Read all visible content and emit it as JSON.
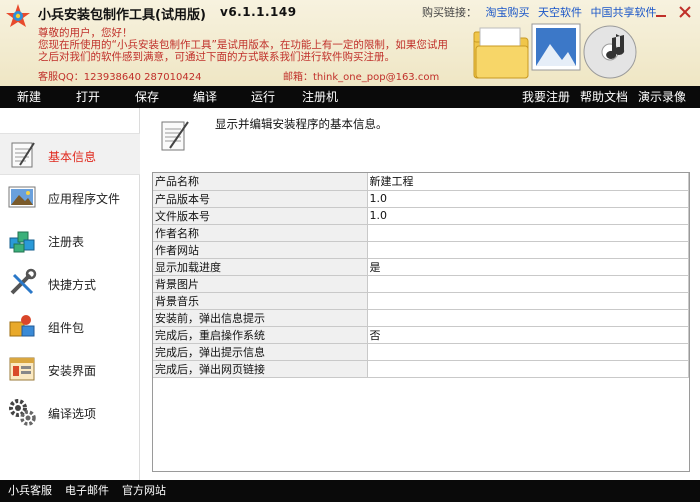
{
  "header": {
    "title": "小兵安装包制作工具(试用版)",
    "version": "v6.1.1.149",
    "buy_label": "购买链接：",
    "buy_links": [
      "淘宝购买",
      "天空软件",
      "中国共享软件"
    ],
    "notice_lines": [
      "尊敬的用户，您好！",
      "您现在所使用的“小兵安装包制作工具”是试用版本，在功能上有一定的限制，如果您试用",
      "之后对我们的软件感到满意，可通过下面的方式联系我们进行软件购买注册。"
    ],
    "contact_qq": "客服QQ：123938640  287010424",
    "contact_mail": "邮箱：think_one_pop@163.com"
  },
  "menu": {
    "left": [
      "新建",
      "打开",
      "保存",
      "编译",
      "运行",
      "注册机"
    ],
    "right": [
      "我要注册",
      "帮助文档",
      "演示录像"
    ]
  },
  "sidebar": {
    "items": [
      {
        "label": "基本信息",
        "icon": "notepad-icon",
        "active": true
      },
      {
        "label": "应用程序文件",
        "icon": "picture-icon",
        "active": false
      },
      {
        "label": "注册表",
        "icon": "registry-icon",
        "active": false
      },
      {
        "label": "快捷方式",
        "icon": "tools-icon",
        "active": false
      },
      {
        "label": "组件包",
        "icon": "components-icon",
        "active": false
      },
      {
        "label": "安装界面",
        "icon": "window-icon",
        "active": false
      },
      {
        "label": "编译选项",
        "icon": "gears-icon",
        "active": false
      }
    ]
  },
  "main": {
    "description": "显示并编辑安装程序的基本信息。",
    "properties": [
      {
        "key": "产品名称",
        "value": "新建工程"
      },
      {
        "key": "产品版本号",
        "value": "1.0"
      },
      {
        "key": "文件版本号",
        "value": "1.0"
      },
      {
        "key": "作者名称",
        "value": ""
      },
      {
        "key": "作者网站",
        "value": ""
      },
      {
        "key": "显示加载进度",
        "value": "是"
      },
      {
        "key": "背景图片",
        "value": ""
      },
      {
        "key": "背景音乐",
        "value": ""
      },
      {
        "key": "安装前，弹出信息提示",
        "value": ""
      },
      {
        "key": "完成后，重启操作系统",
        "value": "否"
      },
      {
        "key": "完成后，弹出提示信息",
        "value": ""
      },
      {
        "key": "完成后，弹出网页链接",
        "value": ""
      }
    ]
  },
  "footer": {
    "links": [
      "小兵客服",
      "电子邮件",
      "官方网站"
    ]
  },
  "colors": {
    "menubar_bg": "#0a0a0a",
    "header_bg": "#efe6c4",
    "notice_red": "#c0302a",
    "active_red": "#e0291e",
    "link_blue": "#1a56c8"
  }
}
